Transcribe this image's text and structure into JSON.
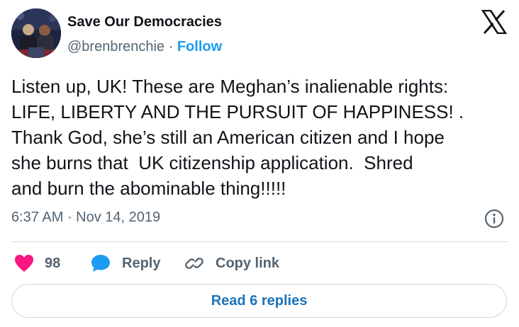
{
  "author": {
    "name": "Save Our Democracies",
    "handle": "@brenbrenchie",
    "separator": " · ",
    "follow_label": "Follow"
  },
  "tweet": {
    "lines": [
      "Listen up, UK! These are Meghan’s inalienable rights:",
      "LIFE, LIBERTY AND THE PURSUIT OF HAPPINESS! .",
      "Thank God, she’s still an American citizen and I hope",
      "she burns that  UK citizenship application.  Shred",
      "and burn the abominable thing!!!!!"
    ],
    "timestamp": "6:37 AM · Nov 14, 2019"
  },
  "actions": {
    "like_count": "98",
    "reply_label": "Reply",
    "copy_link_label": "Copy link"
  },
  "read_replies_label": "Read 6 replies",
  "icons": {
    "brand": "x-logo-icon",
    "info": "info-icon",
    "like": "heart-icon",
    "reply": "speech-bubble-icon",
    "copy": "link-icon"
  },
  "colors": {
    "accent": "#1d9bf0",
    "like": "#f91880",
    "muted": "#536471",
    "text": "#0f1419",
    "border": "#cfd9de"
  }
}
